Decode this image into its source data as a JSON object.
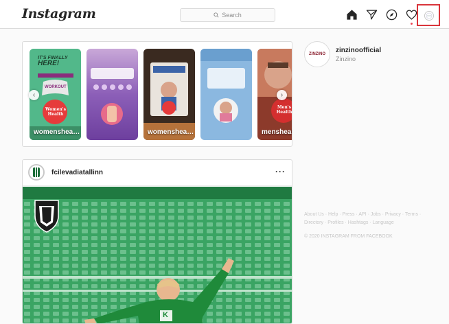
{
  "header": {
    "logo": "Instagram",
    "search_placeholder": "Search",
    "icons": [
      "home-icon",
      "direct-icon",
      "explore-icon",
      "activity-icon",
      "profile-avatar"
    ]
  },
  "stories": [
    {
      "label": "womenshea…",
      "icon": "womens-health-story"
    },
    {
      "label": "",
      "icon": "event-story"
    },
    {
      "label": "womenshea…",
      "icon": "womens-health-story"
    },
    {
      "label": "",
      "icon": "infographic-story"
    },
    {
      "label": "menshealt…",
      "icon": "mens-health-story"
    }
  ],
  "stories_text": {
    "story1_headline_1": "IT'S FINALLY",
    "story1_headline_2": "HERE!",
    "story1_badge": "WORKOUT",
    "story1_brand": "Women's Health",
    "story5_brand": "Men's Health"
  },
  "post": {
    "username": "fcilevadiatallinn",
    "more": "···",
    "jersey": "K"
  },
  "sidebar": {
    "username": "zinzinoofficial",
    "name": "Zinzino",
    "avatar_text": "ZINZINO"
  },
  "footer": {
    "links": "About Us · Help · Press · API · Jobs · Privacy · Terms · Directory · Profiles · Hashtags · Language",
    "copyright": "© 2020 INSTAGRAM FROM FACEBOOK"
  },
  "colors": {
    "highlight_box": "#d9343a",
    "notification_dot": "#ed4956",
    "pitch_green": "#2fa35b",
    "jersey_green": "#1f8a3a"
  }
}
